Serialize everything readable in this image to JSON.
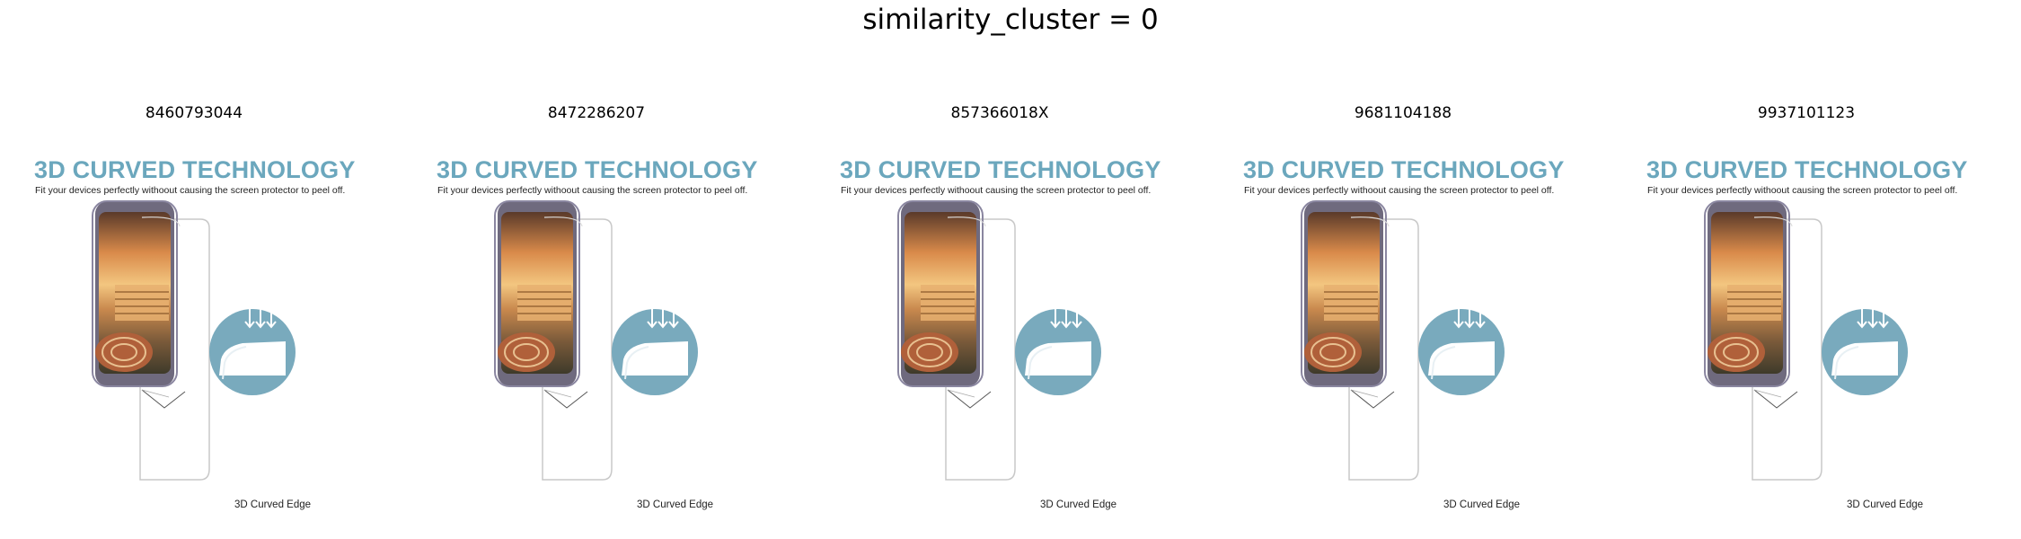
{
  "figure": {
    "title": "similarity_cluster = 0"
  },
  "panels": [
    {
      "label": "8460793044",
      "headline": "3D CURVED TECHNOLOGY",
      "subline": "Fit your devices perfectly withoout causing the screen protector to peel off.",
      "edge_label": "3D Curved Edge"
    },
    {
      "label": "8472286207",
      "headline": "3D CURVED TECHNOLOGY",
      "subline": "Fit your devices perfectly withoout causing the screen protector to peel off.",
      "edge_label": "3D Curved Edge"
    },
    {
      "label": "857366018X",
      "headline": "3D CURVED TECHNOLOGY",
      "subline": "Fit your devices perfectly withoout causing the screen protector to peel off.",
      "edge_label": "3D Curved Edge"
    },
    {
      "label": "9681104188",
      "headline": "3D CURVED TECHNOLOGY",
      "subline": "Fit your devices perfectly withoout causing the screen protector to peel off.",
      "edge_label": "3D Curved Edge"
    },
    {
      "label": "9937101123",
      "headline": "3D CURVED TECHNOLOGY",
      "subline": "Fit your devices perfectly withoout causing the screen protector to peel off.",
      "edge_label": "3D Curved Edge"
    }
  ],
  "colors": {
    "headline": "#6ba7bd",
    "badge": "#79aabd",
    "phone_frame": "#6f6a7e"
  },
  "icons": [
    "curved-edge-icon",
    "phone-image",
    "screen-protector-outline"
  ]
}
